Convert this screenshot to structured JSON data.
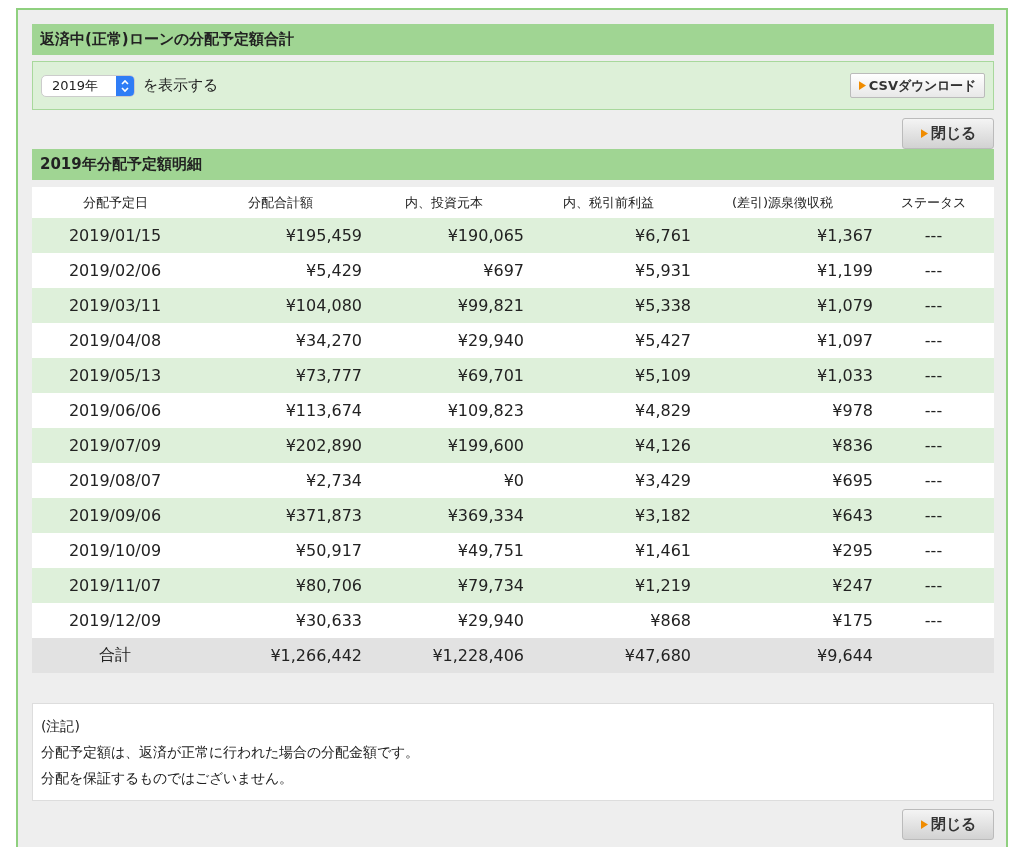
{
  "summary_title": "返済中(正常)ローンの分配予定額合計",
  "year_select": {
    "value": "2019年"
  },
  "select_suffix": "を表示する",
  "csv_button": "CSVダウンロード",
  "close_buttons": [
    "閉じる",
    "閉じる"
  ],
  "detail_title": "2019年分配予定額明細",
  "table": {
    "columns": [
      "分配予定日",
      "分配合計額",
      "内、投資元本",
      "内、税引前利益",
      "(差引)源泉徴収税",
      "ステータス"
    ],
    "rows": [
      [
        "2019/01/15",
        "¥195,459",
        "¥190,065",
        "¥6,761",
        "¥1,367",
        "---"
      ],
      [
        "2019/02/06",
        "¥5,429",
        "¥697",
        "¥5,931",
        "¥1,199",
        "---"
      ],
      [
        "2019/03/11",
        "¥104,080",
        "¥99,821",
        "¥5,338",
        "¥1,079",
        "---"
      ],
      [
        "2019/04/08",
        "¥34,270",
        "¥29,940",
        "¥5,427",
        "¥1,097",
        "---"
      ],
      [
        "2019/05/13",
        "¥73,777",
        "¥69,701",
        "¥5,109",
        "¥1,033",
        "---"
      ],
      [
        "2019/06/06",
        "¥113,674",
        "¥109,823",
        "¥4,829",
        "¥978",
        "---"
      ],
      [
        "2019/07/09",
        "¥202,890",
        "¥199,600",
        "¥4,126",
        "¥836",
        "---"
      ],
      [
        "2019/08/07",
        "¥2,734",
        "¥0",
        "¥3,429",
        "¥695",
        "---"
      ],
      [
        "2019/09/06",
        "¥371,873",
        "¥369,334",
        "¥3,182",
        "¥643",
        "---"
      ],
      [
        "2019/10/09",
        "¥50,917",
        "¥49,751",
        "¥1,461",
        "¥295",
        "---"
      ],
      [
        "2019/11/07",
        "¥80,706",
        "¥79,734",
        "¥1,219",
        "¥247",
        "---"
      ],
      [
        "2019/12/09",
        "¥30,633",
        "¥29,940",
        "¥868",
        "¥175",
        "---"
      ]
    ],
    "total": [
      "合計",
      "¥1,266,442",
      "¥1,228,406",
      "¥47,680",
      "¥9,644"
    ]
  },
  "notes": [
    "(注記)",
    "分配予定額は、返済が正常に行われた場合の分配金額です。",
    "分配を保証するものではございません。"
  ]
}
